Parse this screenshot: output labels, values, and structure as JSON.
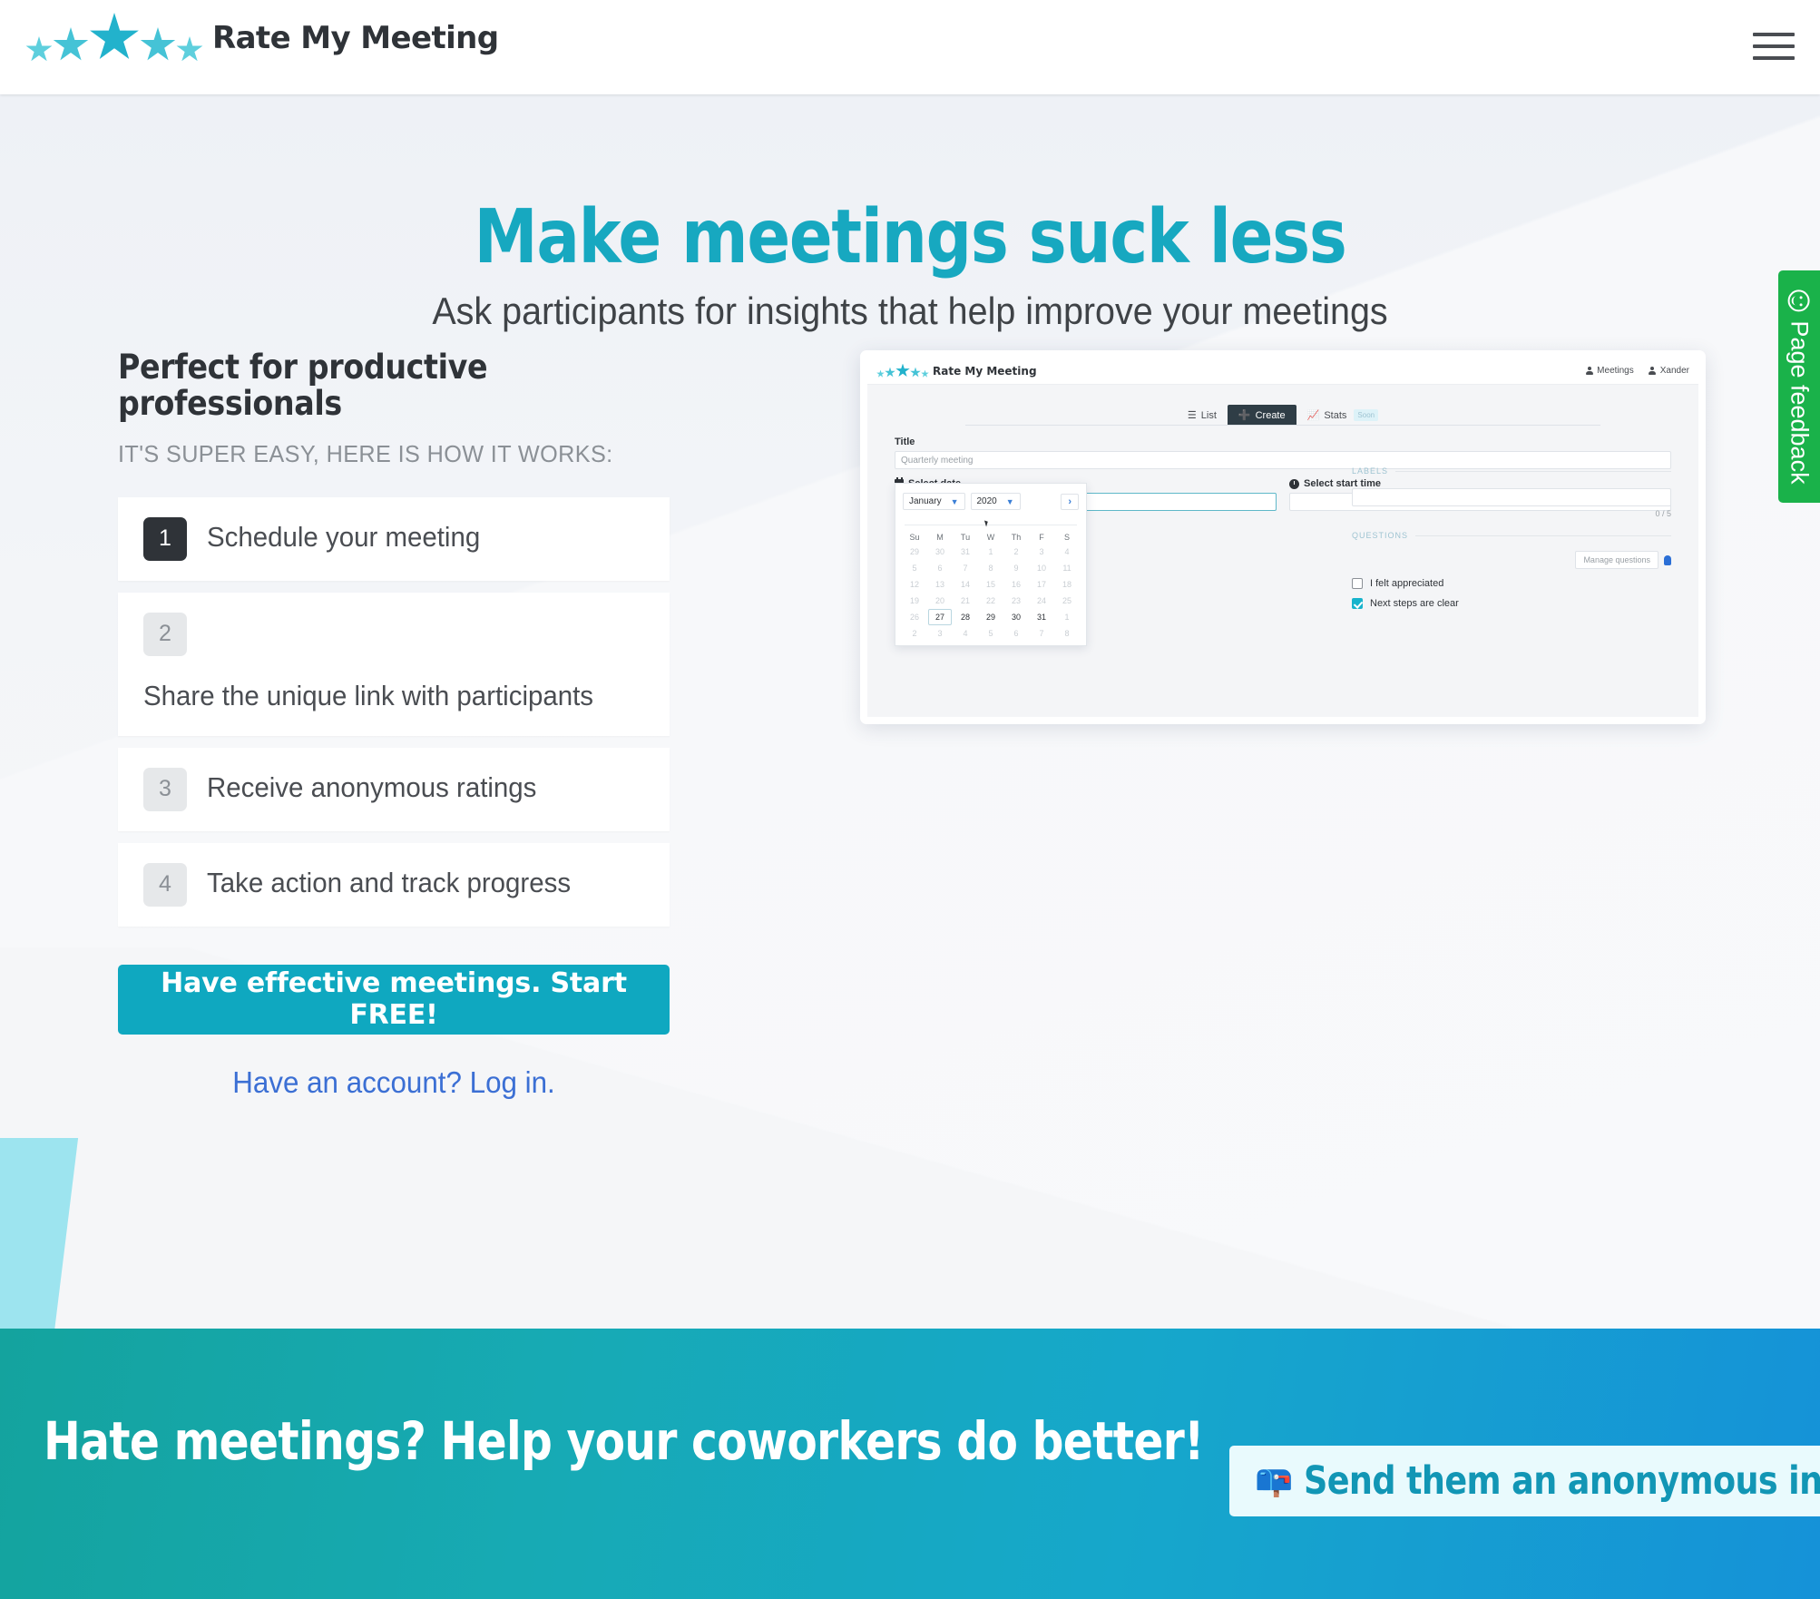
{
  "brand": {
    "name": "Rate My Meeting",
    "logo_icon": "five-stars-icon"
  },
  "topbar": {
    "menu_icon": "hamburger-menu-icon"
  },
  "feedback_tab": {
    "label": "Page feedback",
    "icon": "smiley-face-icon",
    "color": "#1ab24a"
  },
  "hero": {
    "title": "Make meetings suck less",
    "subtitle": "Ask participants for insights that help improve your meetings",
    "title_color": "#17a8c0"
  },
  "left": {
    "section_title": "Perfect for productive professionals",
    "kicker": "IT'S SUPER EASY, HERE IS HOW IT WORKS:",
    "steps": [
      {
        "number": "1",
        "label": "Schedule your meeting",
        "active": true
      },
      {
        "number": "2",
        "label": "Share the unique link with participants",
        "active": false
      },
      {
        "number": "3",
        "label": "Receive anonymous ratings",
        "active": false
      },
      {
        "number": "4",
        "label": "Take action and track progress",
        "active": false
      }
    ],
    "cta_label": "Have effective meetings. Start FREE!",
    "cta_color": "#0fa8c0",
    "login_link": "Have an account? Log in."
  },
  "mockup": {
    "brand": "Rate My Meeting",
    "header_items": [
      {
        "label": "Meetings",
        "icon": "people-icon"
      },
      {
        "label": "Xander",
        "icon": "user-icon"
      }
    ],
    "tabs": [
      {
        "label": "List",
        "icon": "list-icon",
        "active": false,
        "badge": ""
      },
      {
        "label": "Create",
        "icon": "plus-icon",
        "active": true,
        "badge": ""
      },
      {
        "label": "Stats",
        "icon": "chart-icon",
        "active": false,
        "badge": "Soon"
      }
    ],
    "form": {
      "title_label": "Title",
      "title_placeholder": "Quarterly meeting",
      "date_label": "Select date",
      "date_icon": "calendar-icon",
      "date_value": "",
      "time_label": "Select start time",
      "time_icon": "clock-icon",
      "time_value": ""
    },
    "labels_section": {
      "heading": "LABELS",
      "input_value": "",
      "counter": "0 / 5"
    },
    "questions_section": {
      "heading": "QUESTIONS",
      "manage_button": "Manage questions",
      "hint_icon": "lightbulb-icon",
      "questions": [
        {
          "label": "I felt appreciated",
          "checked": false
        },
        {
          "label": "Next steps are clear",
          "checked": true
        }
      ]
    },
    "calendar": {
      "month": "January",
      "year": "2020",
      "next_icon": "chevron-right-icon",
      "dow": [
        "Su",
        "M",
        "Tu",
        "W",
        "Th",
        "F",
        "S"
      ],
      "weeks": [
        [
          {
            "d": "29",
            "mute": true
          },
          {
            "d": "30",
            "mute": true
          },
          {
            "d": "31",
            "mute": true
          },
          {
            "d": "1",
            "mute": true
          },
          {
            "d": "2",
            "mute": true
          },
          {
            "d": "3",
            "mute": true
          },
          {
            "d": "4",
            "mute": true
          }
        ],
        [
          {
            "d": "5",
            "mute": true
          },
          {
            "d": "6",
            "mute": true
          },
          {
            "d": "7",
            "mute": true
          },
          {
            "d": "8",
            "mute": true
          },
          {
            "d": "9",
            "mute": true
          },
          {
            "d": "10",
            "mute": true
          },
          {
            "d": "11",
            "mute": true
          }
        ],
        [
          {
            "d": "12",
            "mute": true
          },
          {
            "d": "13",
            "mute": true
          },
          {
            "d": "14",
            "mute": true
          },
          {
            "d": "15",
            "mute": true
          },
          {
            "d": "16",
            "mute": true
          },
          {
            "d": "17",
            "mute": true
          },
          {
            "d": "18",
            "mute": true
          }
        ],
        [
          {
            "d": "19",
            "mute": true
          },
          {
            "d": "20",
            "mute": true
          },
          {
            "d": "21",
            "mute": true
          },
          {
            "d": "22",
            "mute": true
          },
          {
            "d": "23",
            "mute": true
          },
          {
            "d": "24",
            "mute": true
          },
          {
            "d": "25",
            "mute": true
          }
        ],
        [
          {
            "d": "26",
            "mute": true
          },
          {
            "d": "27",
            "mute": false,
            "selected": true
          },
          {
            "d": "28",
            "mute": false
          },
          {
            "d": "29",
            "mute": false
          },
          {
            "d": "30",
            "mute": false
          },
          {
            "d": "31",
            "mute": false
          },
          {
            "d": "1",
            "mute": true
          }
        ],
        [
          {
            "d": "2",
            "mute": true
          },
          {
            "d": "3",
            "mute": true
          },
          {
            "d": "4",
            "mute": true
          },
          {
            "d": "5",
            "mute": true
          },
          {
            "d": "6",
            "mute": true
          },
          {
            "d": "7",
            "mute": true
          },
          {
            "d": "8",
            "mute": true
          }
        ]
      ]
    }
  },
  "banner": {
    "headline": "Hate meetings? Help your coworkers do better!",
    "invite_label": "Send them an anonymous invite",
    "invite_icon": "envelope-icon",
    "invite_text_color": "#1296b5"
  }
}
